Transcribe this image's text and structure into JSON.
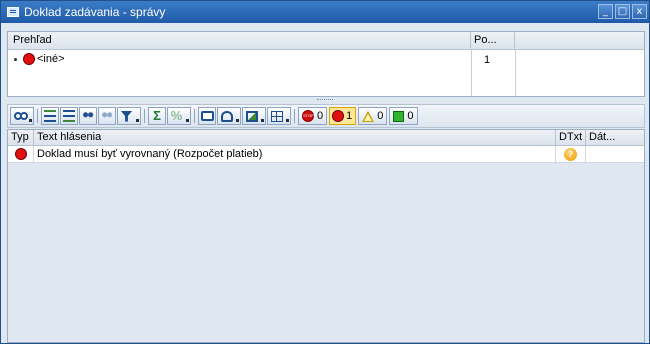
{
  "window": {
    "title": "Doklad zadávania - správy",
    "controls": [
      "_",
      "□",
      "x"
    ]
  },
  "overview": {
    "col_overview": "Prehľad",
    "col_count": "Po...",
    "row": {
      "label": "<iné>",
      "count": "1",
      "status": "error"
    }
  },
  "toolbar": {
    "error_count": "0",
    "error_alt_count": "1",
    "warning_count": "0",
    "ok_count": "0"
  },
  "messages": {
    "col_type": "Typ",
    "col_text": "Text hlásenia",
    "col_dtxt": "DTxt",
    "col_date": "Dát...",
    "rows": [
      {
        "type": "error",
        "text": "Doklad musí byť vyrovnaný (Rozpočet platieb)",
        "dtxt": "?"
      }
    ]
  },
  "colors": {
    "title_bar": "#1e5aa8",
    "error": "#e01010",
    "warning": "#c8a000",
    "ok": "#2fb52f"
  }
}
